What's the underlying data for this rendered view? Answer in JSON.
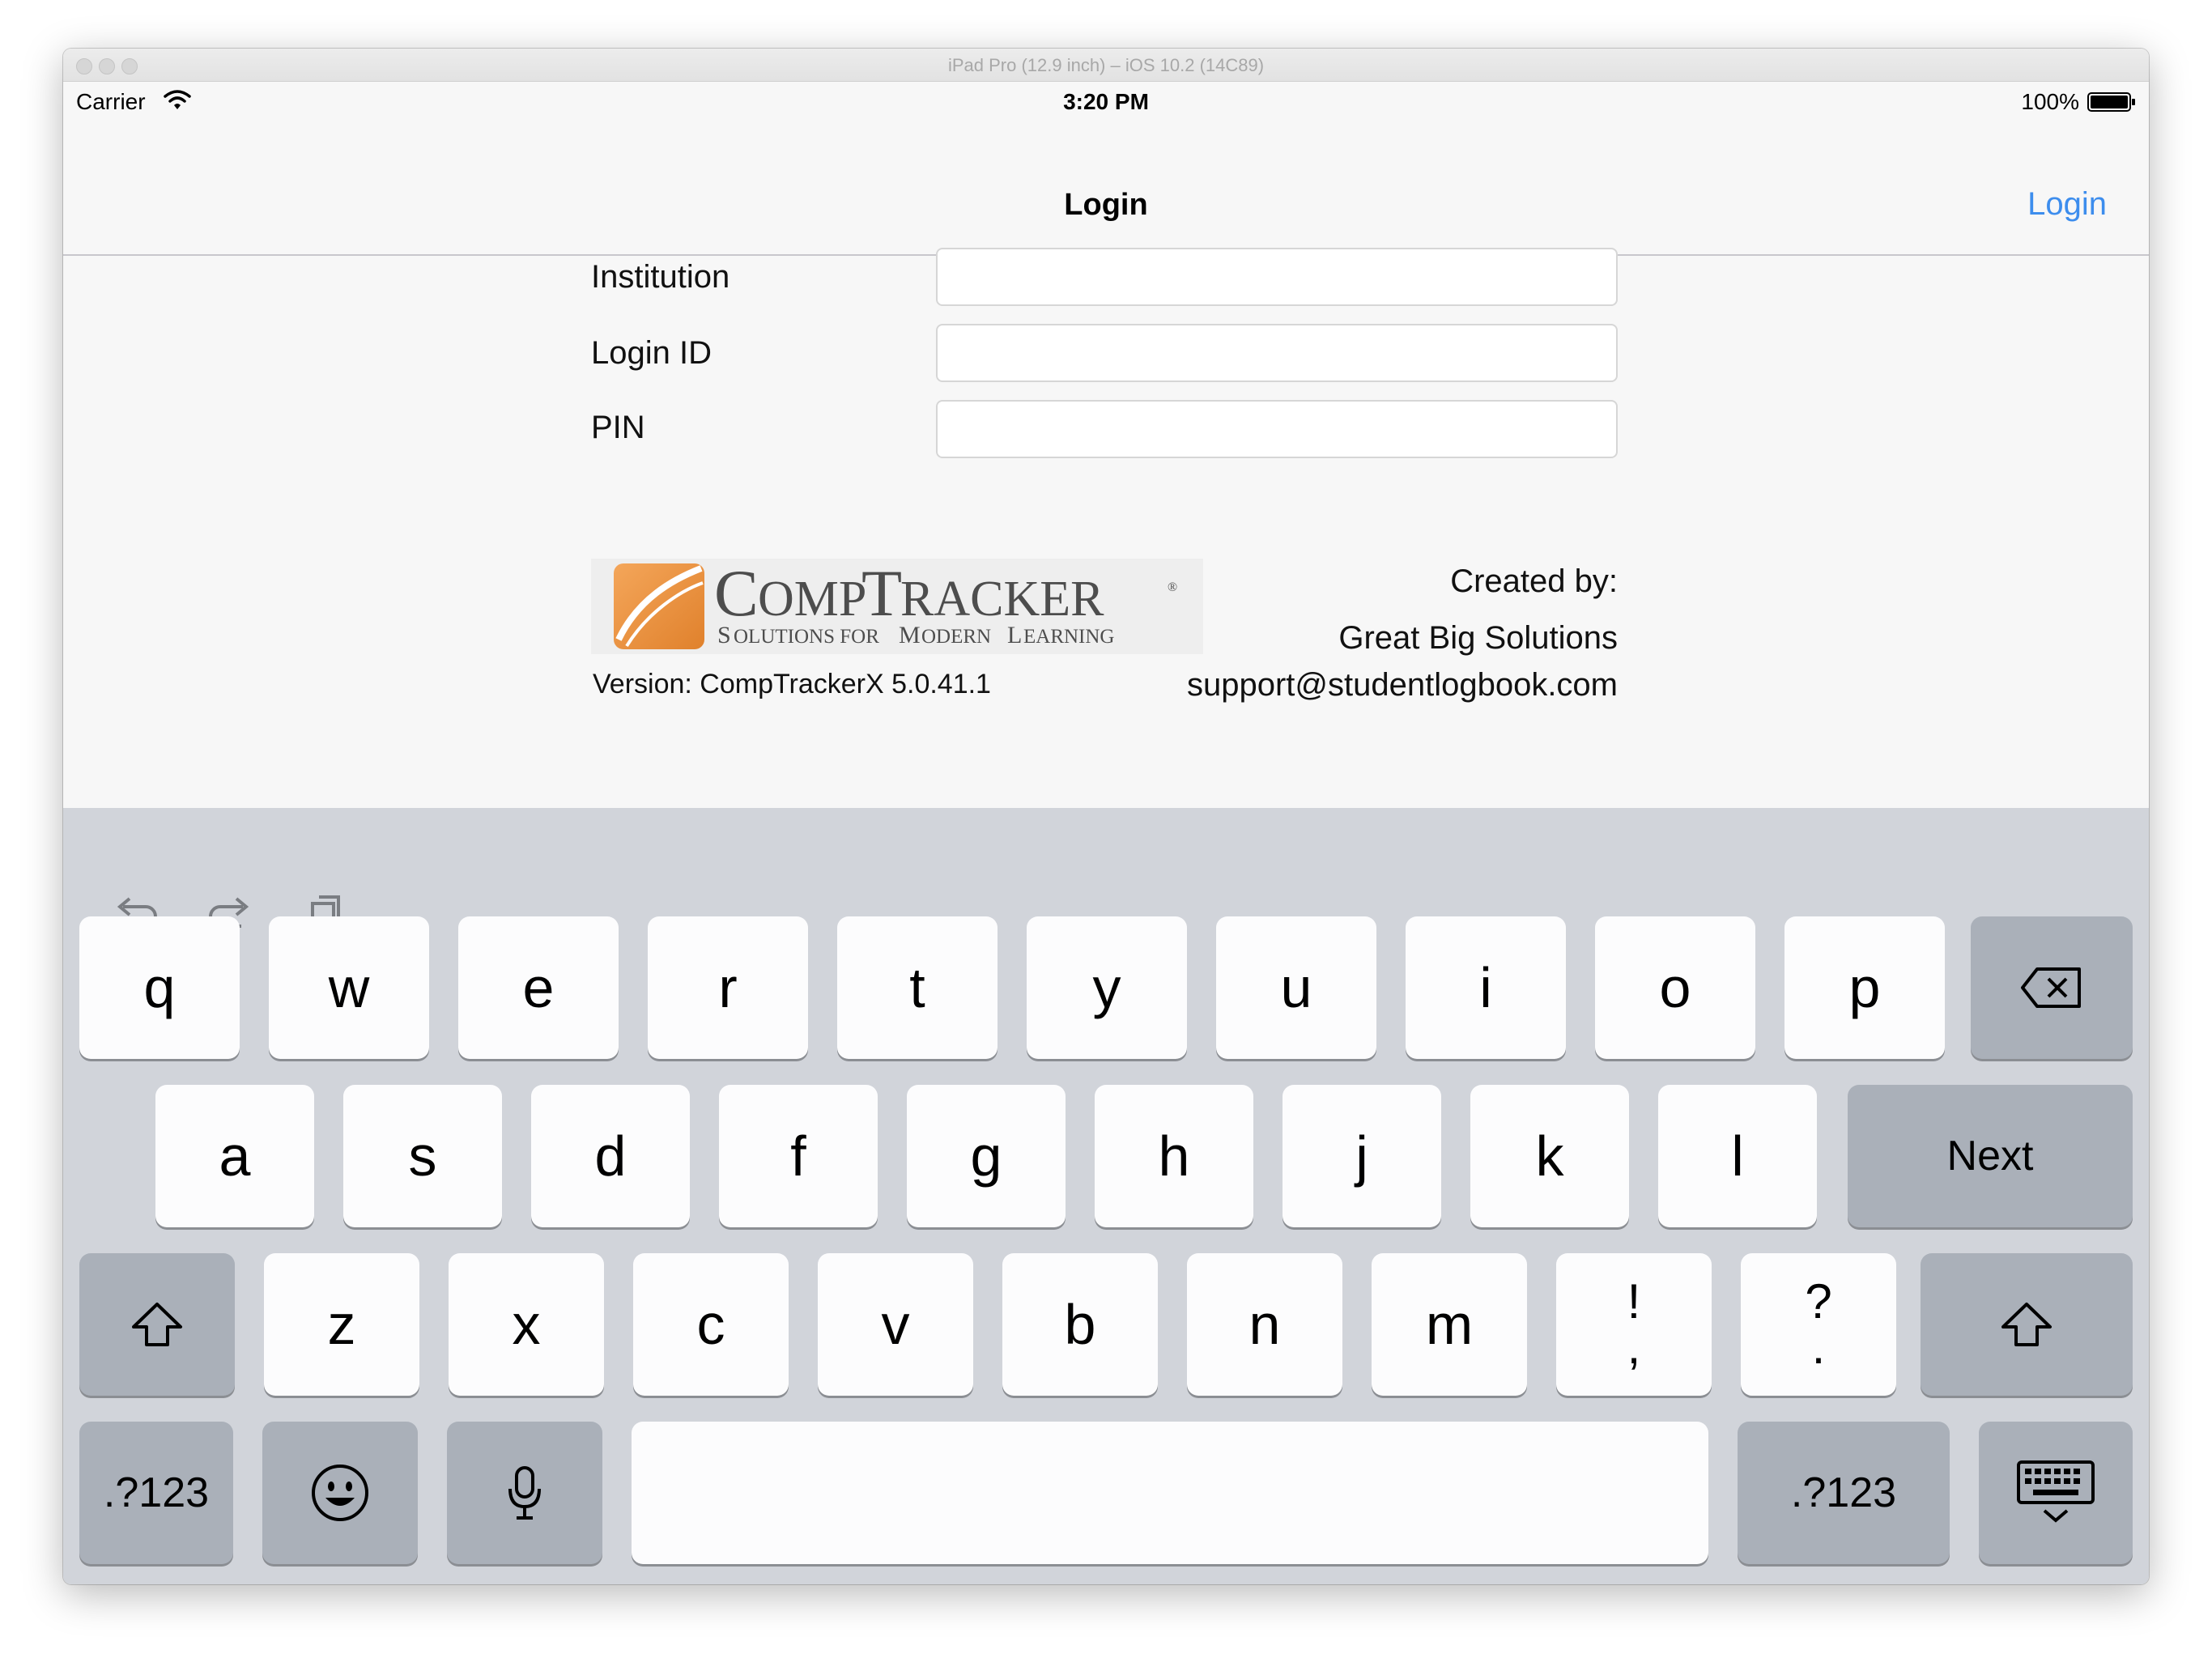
{
  "simulator": {
    "title": "iPad Pro (12.9 inch) – iOS 10.2 (14C89)"
  },
  "statusbar": {
    "carrier": "Carrier",
    "time": "3:20 PM",
    "battery": "100%"
  },
  "navbar": {
    "title": "Login",
    "right_button": "Login",
    "tint_color": "#3d8ded"
  },
  "form": {
    "fields": [
      {
        "label": "Institution",
        "value": ""
      },
      {
        "label": "Login ID",
        "value": ""
      },
      {
        "label": "PIN",
        "value": ""
      }
    ]
  },
  "footer": {
    "logo_title": "CompTracker",
    "logo_subtitle": "Solutions for Modern Learning",
    "version": "Version: CompTrackerX 5.0.41.1",
    "created_by": "Created by:",
    "company": "Great Big Solutions",
    "email": "support@studentlogbook.com"
  },
  "keyboard": {
    "row1": [
      "q",
      "w",
      "e",
      "r",
      "t",
      "y",
      "u",
      "i",
      "o",
      "p"
    ],
    "row2": [
      "a",
      "s",
      "d",
      "f",
      "g",
      "h",
      "j",
      "k",
      "l"
    ],
    "row3": [
      "z",
      "x",
      "c",
      "v",
      "b",
      "n",
      "m"
    ],
    "punct1": [
      "!",
      ","
    ],
    "punct2": [
      "?",
      "."
    ],
    "next": "Next",
    "numbers": ".?123"
  }
}
